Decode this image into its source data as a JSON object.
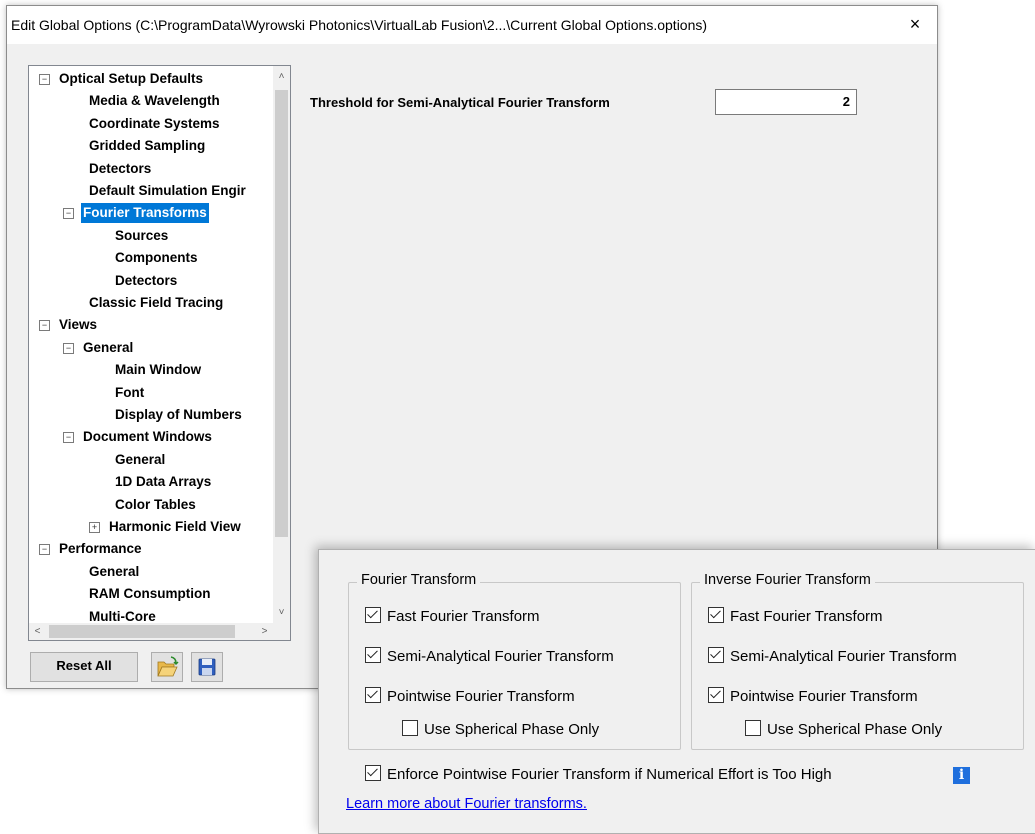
{
  "window": {
    "title": "Edit Global Options (C:\\ProgramData\\Wyrowski Photonics\\VirtualLab Fusion\\2...\\Current Global Options.options)",
    "close_glyph": "×"
  },
  "tree": {
    "items": [
      {
        "label": "Optical Setup Defaults",
        "expander": "−"
      },
      {
        "label": "Media & Wavelength"
      },
      {
        "label": "Coordinate Systems"
      },
      {
        "label": "Gridded Sampling"
      },
      {
        "label": "Detectors"
      },
      {
        "label": "Default Simulation Engir"
      },
      {
        "label": "Fourier Transforms",
        "expander": "−",
        "selected": true
      },
      {
        "label": "Sources"
      },
      {
        "label": "Components"
      },
      {
        "label": "Detectors"
      },
      {
        "label": "Classic Field Tracing"
      },
      {
        "label": "Views",
        "expander": "−"
      },
      {
        "label": "General",
        "expander": "−"
      },
      {
        "label": "Main Window"
      },
      {
        "label": "Font"
      },
      {
        "label": "Display of Numbers"
      },
      {
        "label": "Document Windows",
        "expander": "−"
      },
      {
        "label": "General"
      },
      {
        "label": "1D Data Arrays"
      },
      {
        "label": "Color Tables"
      },
      {
        "label": "Harmonic Field View",
        "expander": "+"
      },
      {
        "label": "Performance",
        "expander": "−"
      },
      {
        "label": "General"
      },
      {
        "label": "RAM Consumption"
      },
      {
        "label": "Multi-Core"
      }
    ],
    "scroll_arrows": {
      "up": "˄",
      "down": "˅",
      "left": "<",
      "right": ">"
    }
  },
  "buttons": {
    "reset_all": "Reset All",
    "open_icon": "folder-open-icon",
    "save_icon": "floppy-disk-icon"
  },
  "settings": {
    "threshold_label": "Threshold for Semi-Analytical Fourier Transform",
    "threshold_value": "2"
  },
  "overlay": {
    "fourier_group": {
      "title": "Fourier Transform",
      "fast": "Fast Fourier Transform",
      "semi": "Semi-Analytical Fourier Transform",
      "pointwise": "Pointwise Fourier Transform",
      "spherical": "Use Spherical Phase Only"
    },
    "inverse_group": {
      "title": "Inverse Fourier Transform",
      "fast": "Fast Fourier Transform",
      "semi": "Semi-Analytical Fourier Transform",
      "pointwise": "Pointwise Fourier Transform",
      "spherical": "Use Spherical Phase Only"
    },
    "enforce": "Enforce Pointwise Fourier Transform if Numerical Effort is Too High",
    "info_glyph": "i",
    "learn_more": "Learn more about Fourier transforms."
  },
  "colors": {
    "selection": "#0078d7",
    "info": "#1f6fdd",
    "link": "#0000ee"
  }
}
